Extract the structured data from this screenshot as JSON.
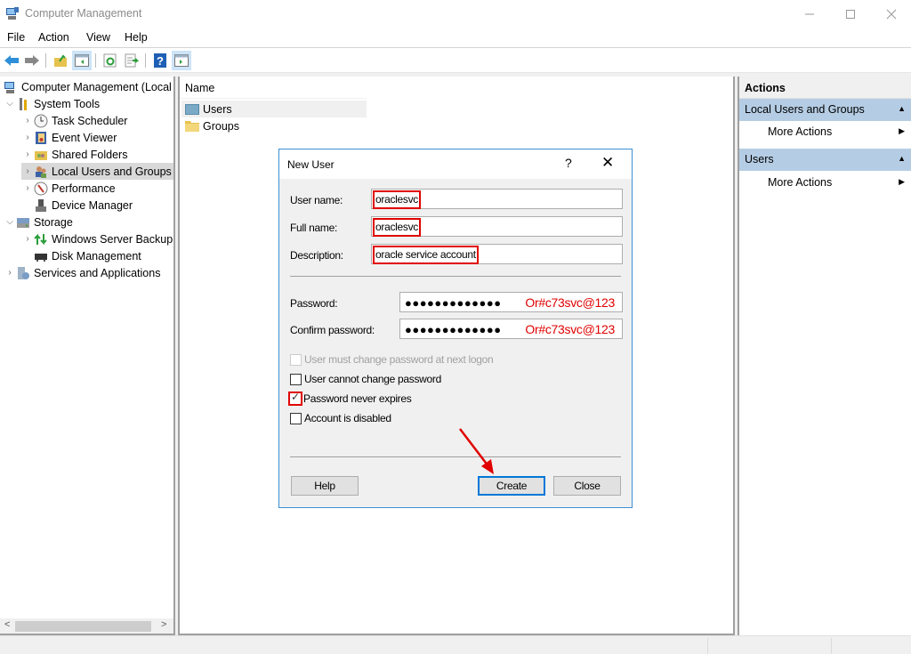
{
  "window": {
    "title": "Computer Management",
    "controls": {
      "minimize": "minimize",
      "maximize": "maximize",
      "close": "close"
    }
  },
  "menu": [
    "File",
    "Action",
    "View",
    "Help"
  ],
  "toolbar": {
    "buttons": [
      "back-icon",
      "forward-icon",
      "up-folder-icon",
      "show-hide-console-tree-icon",
      "refresh-icon",
      "export-list-icon",
      "help-icon",
      "show-hide-action-pane-icon"
    ]
  },
  "tree": {
    "root": "Computer Management (Local",
    "items": [
      {
        "label": "System Tools",
        "level": 1,
        "expanded": true
      },
      {
        "label": "Task Scheduler",
        "level": 2
      },
      {
        "label": "Event Viewer",
        "level": 2
      },
      {
        "label": "Shared Folders",
        "level": 2
      },
      {
        "label": "Local Users and Groups",
        "level": 2,
        "selected": true
      },
      {
        "label": "Performance",
        "level": 2
      },
      {
        "label": "Device Manager",
        "level": 2
      },
      {
        "label": "Storage",
        "level": 1,
        "expanded": true
      },
      {
        "label": "Windows Server Backup",
        "level": 2
      },
      {
        "label": "Disk Management",
        "level": 2
      },
      {
        "label": "Services and Applications",
        "level": 1
      }
    ]
  },
  "list": {
    "column": "Name",
    "rows": [
      "Users",
      "Groups"
    ]
  },
  "actions": {
    "title": "Actions",
    "groups": [
      {
        "label": "Local Users and Groups",
        "item": "More Actions"
      },
      {
        "label": "Users",
        "item": "More Actions"
      }
    ]
  },
  "dialog": {
    "title": "New User",
    "help_glyph": "?",
    "close_glyph": "✕",
    "fields": {
      "username": {
        "label": "User name:",
        "value": "oraclesvc"
      },
      "fullname": {
        "label": "Full name:",
        "value": "oraclesvc"
      },
      "description": {
        "label": "Description:",
        "value": "oracle service account"
      },
      "password": {
        "label": "Password:",
        "masked": "●●●●●●●●●●●●●",
        "annotation": "Or#c73svc@123"
      },
      "confirm": {
        "label": "Confirm password:",
        "masked": "●●●●●●●●●●●●●",
        "annotation": "Or#c73svc@123"
      }
    },
    "checkboxes": [
      {
        "label": "User must change password at next logon",
        "checked": false,
        "disabled": true
      },
      {
        "label": "User cannot change password",
        "checked": false,
        "disabled": false
      },
      {
        "label": "Password never expires",
        "checked": true,
        "disabled": false
      },
      {
        "label": "Account is disabled",
        "checked": false,
        "disabled": false
      }
    ],
    "buttons": {
      "help": "Help",
      "create": "Create",
      "close": "Close"
    }
  },
  "colors": {
    "annotation_red": "#e00000",
    "dialog_border": "#3c8fd6",
    "actions_group_bg": "#b5cde4",
    "default_button_border": "#0078d7"
  }
}
